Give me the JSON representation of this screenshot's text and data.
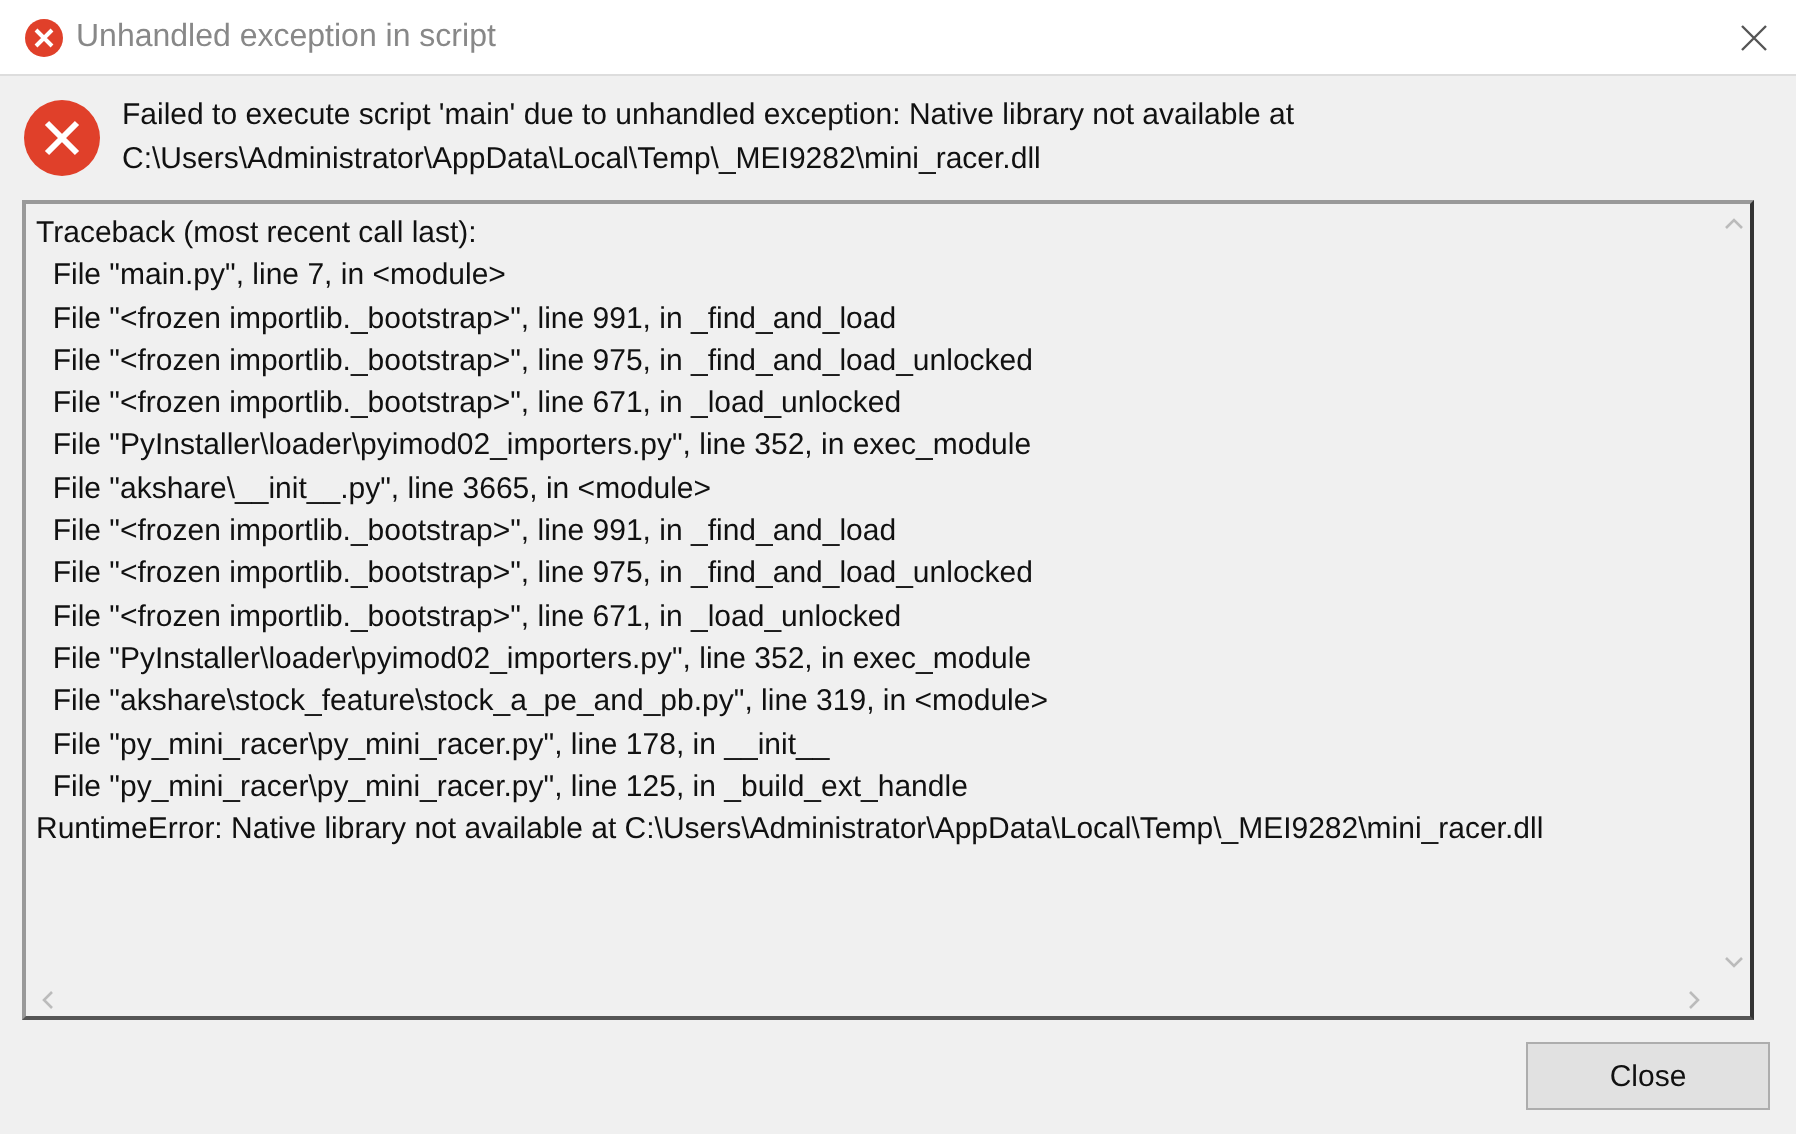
{
  "window": {
    "title": "Unhandled exception in script"
  },
  "message": {
    "lines": [
      "Failed to execute script 'main' due to unhandled exception: Native library not available at",
      "C:\\Users\\Administrator\\AppData\\Local\\Temp\\_MEI9282\\mini_racer.dll"
    ]
  },
  "traceback": [
    "Traceback (most recent call last):",
    "  File \"main.py\", line 7, in <module>",
    "  File \"<frozen importlib._bootstrap>\", line 991, in _find_and_load",
    "  File \"<frozen importlib._bootstrap>\", line 975, in _find_and_load_unlocked",
    "  File \"<frozen importlib._bootstrap>\", line 671, in _load_unlocked",
    "  File \"PyInstaller\\loader\\pyimod02_importers.py\", line 352, in exec_module",
    "  File \"akshare\\__init__.py\", line 3665, in <module>",
    "  File \"<frozen importlib._bootstrap>\", line 991, in _find_and_load",
    "  File \"<frozen importlib._bootstrap>\", line 975, in _find_and_load_unlocked",
    "  File \"<frozen importlib._bootstrap>\", line 671, in _load_unlocked",
    "  File \"PyInstaller\\loader\\pyimod02_importers.py\", line 352, in exec_module",
    "  File \"akshare\\stock_feature\\stock_a_pe_and_pb.py\", line 319, in <module>",
    "  File \"py_mini_racer\\py_mini_racer.py\", line 178, in __init__",
    "  File \"py_mini_racer\\py_mini_racer.py\", line 125, in _build_ext_handle",
    "RuntimeError: Native library not available at C:\\Users\\Administrator\\AppData\\Local\\Temp\\_MEI9282\\mini_racer.dll"
  ],
  "buttons": [
    "Close"
  ]
}
